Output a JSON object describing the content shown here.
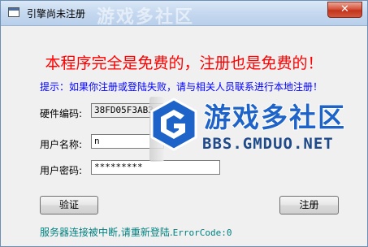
{
  "window": {
    "title": "引擎尚未注册",
    "title_watermark": "游戏多社区",
    "close_label": "✕"
  },
  "main": {
    "headline": "本程序完全是免费的，注册也是免费的！",
    "hint": "提示：如果你注册或登陆失败，请与相关人员联系进行本地注册！"
  },
  "form": {
    "hardware_code_label": "硬件编码:",
    "hardware_code_value": "38FD05F3AB3",
    "username_label": "用户名称:",
    "username_value": "n",
    "password_label": "用户密码:",
    "password_value": "*********"
  },
  "buttons": {
    "verify_label": "验证",
    "register_label": "注册"
  },
  "status": {
    "message": "服务器连接被中断,请重新登陆.",
    "error_code": "ErrorCode:0"
  },
  "watermark": {
    "main": "游戏多社区",
    "sub": "BBS.GMDUO.NET",
    "logo_icon": "gmduo-logo-icon"
  },
  "colors": {
    "headline": "#ff0000",
    "hint": "#0000ff",
    "status": "#008080",
    "watermark": "#1e63c8"
  }
}
